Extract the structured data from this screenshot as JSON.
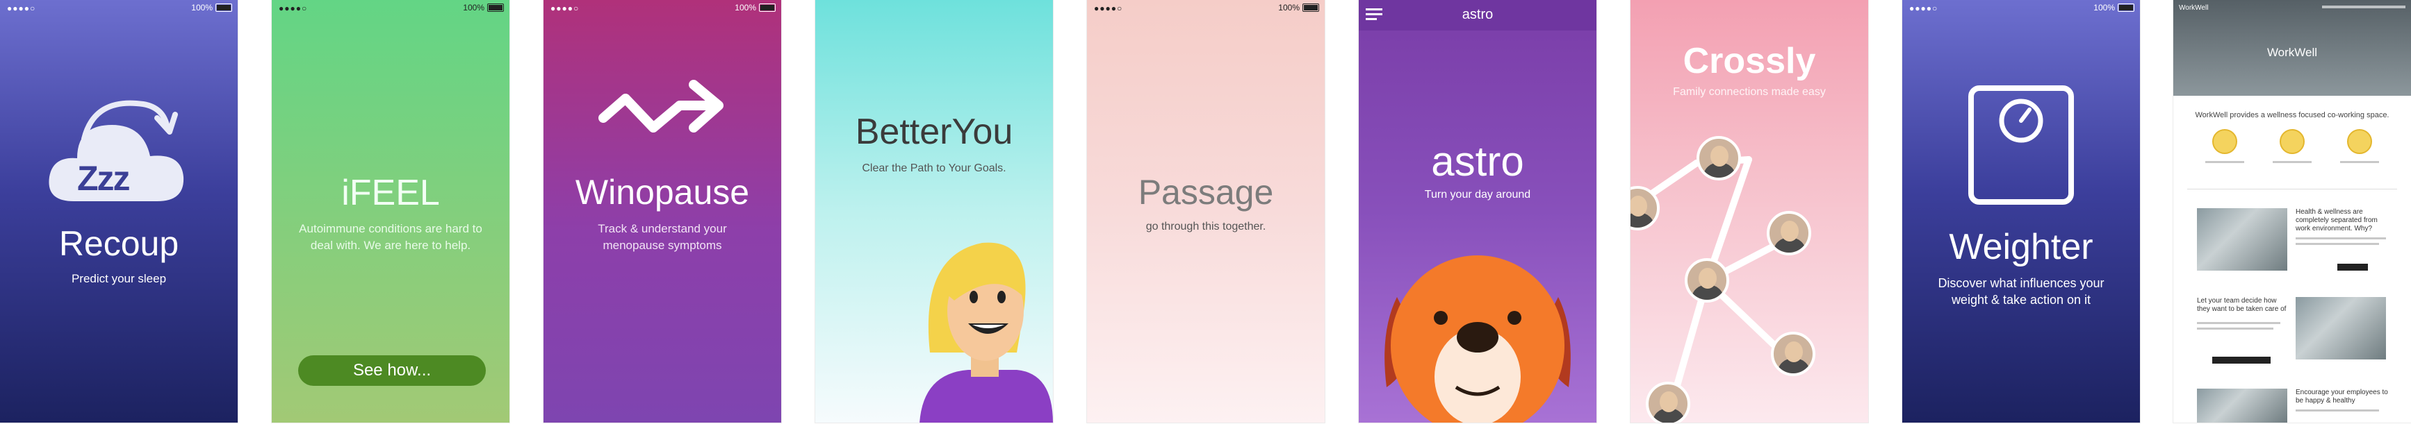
{
  "status_bar": {
    "signal": "●●●●○",
    "battery_pct": "100%"
  },
  "screens": {
    "recoup": {
      "title": "Recoup",
      "subtitle": "Predict your sleep",
      "icon_text": "Zzz"
    },
    "ifeel": {
      "title": "iFEEL",
      "subtitle": "Autoimmune conditions are hard to deal with. We are here to help.",
      "button": "See how..."
    },
    "winopause": {
      "title": "Winopause",
      "subtitle": "Track & understand your menopause symptoms"
    },
    "betteryou": {
      "title": "BetterYou",
      "subtitle": "Clear the Path to Your Goals."
    },
    "passage": {
      "title": "Passage",
      "subtitle": "go through this together."
    },
    "astro": {
      "header": "astro",
      "title": "astro",
      "subtitle": "Turn your day around"
    },
    "crossly": {
      "title": "Crossly",
      "subtitle": "Family connections made easy"
    },
    "weighter": {
      "title": "Weighter",
      "subtitle": "Discover what influences your weight & take action on it"
    },
    "workwell": {
      "logo": "WorkWell",
      "hero_title": "WorkWell",
      "intro": "WorkWell provides a wellness focused co-working space.",
      "sec1_title": "Health & wellness are completely separated from work environment. Why?",
      "sec2_title": "Let your team decide how they want to be taken care of",
      "sec3_title": "Encourage your employees to be happy & healthy"
    }
  },
  "colors": {
    "indigo": "#3c3f9c",
    "green": "#63d585",
    "purple": "#8d3faa",
    "teal": "#6ee1dc",
    "pink": "#f3a0b2",
    "button_green": "#4d8a23"
  }
}
